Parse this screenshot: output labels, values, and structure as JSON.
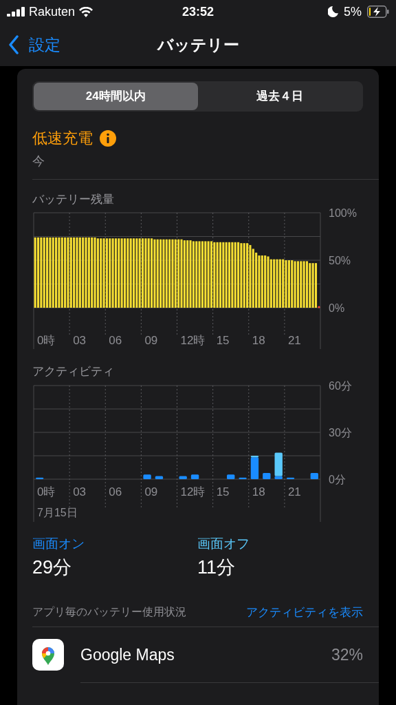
{
  "status_bar": {
    "carrier": "Rakuten",
    "time": "23:52",
    "battery": "5%"
  },
  "nav": {
    "back": "設定",
    "title": "バッテリー"
  },
  "segments": [
    {
      "label": "24時間以内",
      "selected": true
    },
    {
      "label": "過去４日",
      "selected": false
    }
  ],
  "charging": {
    "title": "低速充電",
    "time": "今"
  },
  "battery_chart": {
    "title": "バッテリー残量",
    "x_labels": [
      "0時",
      "03",
      "06",
      "09",
      "12時",
      "15",
      "18",
      "21"
    ],
    "chart_data": {
      "type": "bar",
      "ylim": [
        0,
        100
      ],
      "yticks": [
        {
          "value": 100,
          "label": "100%"
        },
        {
          "value": 50,
          "label": "50%"
        },
        {
          "value": 0,
          "label": "0%"
        }
      ],
      "series": [
        {
          "color": "#f5de33",
          "values": [
            74,
            74,
            74,
            74,
            74,
            74,
            74,
            74,
            74,
            74,
            74,
            74,
            74,
            74,
            74,
            74,
            74,
            74,
            74,
            74,
            74,
            73,
            73,
            73,
            73,
            73,
            73,
            73,
            73,
            73,
            73,
            73,
            73,
            73,
            73,
            73,
            73,
            73,
            73,
            73,
            72,
            72,
            72,
            72,
            72,
            72,
            72,
            72,
            72,
            72,
            71,
            71,
            71,
            70,
            70,
            70,
            70,
            70,
            70,
            70,
            69,
            69,
            69,
            69,
            69,
            69,
            69,
            69,
            69,
            68,
            68,
            68,
            66,
            62,
            58,
            55,
            55,
            55,
            54,
            51,
            51,
            51,
            51,
            51,
            50,
            50,
            50,
            49,
            49,
            49,
            49,
            49,
            47,
            47,
            47,
            null
          ]
        }
      ]
    }
  },
  "activity_chart": {
    "title": "アクティビティ",
    "date": "7月15日",
    "x_labels": [
      "0時",
      "03",
      "06",
      "09",
      "12時",
      "15",
      "18",
      "21"
    ],
    "chart_data": {
      "type": "bar",
      "stacked": true,
      "ylim": [
        0,
        60
      ],
      "yticks": [
        {
          "value": 60,
          "label": "60分"
        },
        {
          "value": 30,
          "label": "30分"
        },
        {
          "value": 0,
          "label": "0分"
        }
      ],
      "series": [
        {
          "color": "#1a8cff",
          "values": [
            1,
            0,
            0,
            0,
            0,
            0,
            0,
            0,
            0,
            3,
            2,
            0,
            2,
            3,
            0,
            0,
            3,
            1,
            14,
            4,
            2,
            1,
            0,
            4
          ]
        },
        {
          "color": "#5ac8fa",
          "values": [
            0,
            0,
            0,
            0,
            0,
            0,
            0,
            0,
            0,
            0,
            0,
            0,
            0,
            0,
            0,
            0,
            0,
            0,
            1,
            0,
            15,
            0,
            0,
            0
          ]
        }
      ]
    }
  },
  "screen_stats": [
    {
      "label": "画面オン",
      "value": "29分",
      "color": "#1a8cff"
    },
    {
      "label": "画面オフ",
      "value": "11分",
      "color": "#5ac8fa"
    }
  ],
  "usage": {
    "title": "アプリ毎のバッテリー使用状況",
    "link": "アクティビティを表示"
  },
  "apps": [
    {
      "name": "Google Maps",
      "percent": "32%"
    }
  ]
}
